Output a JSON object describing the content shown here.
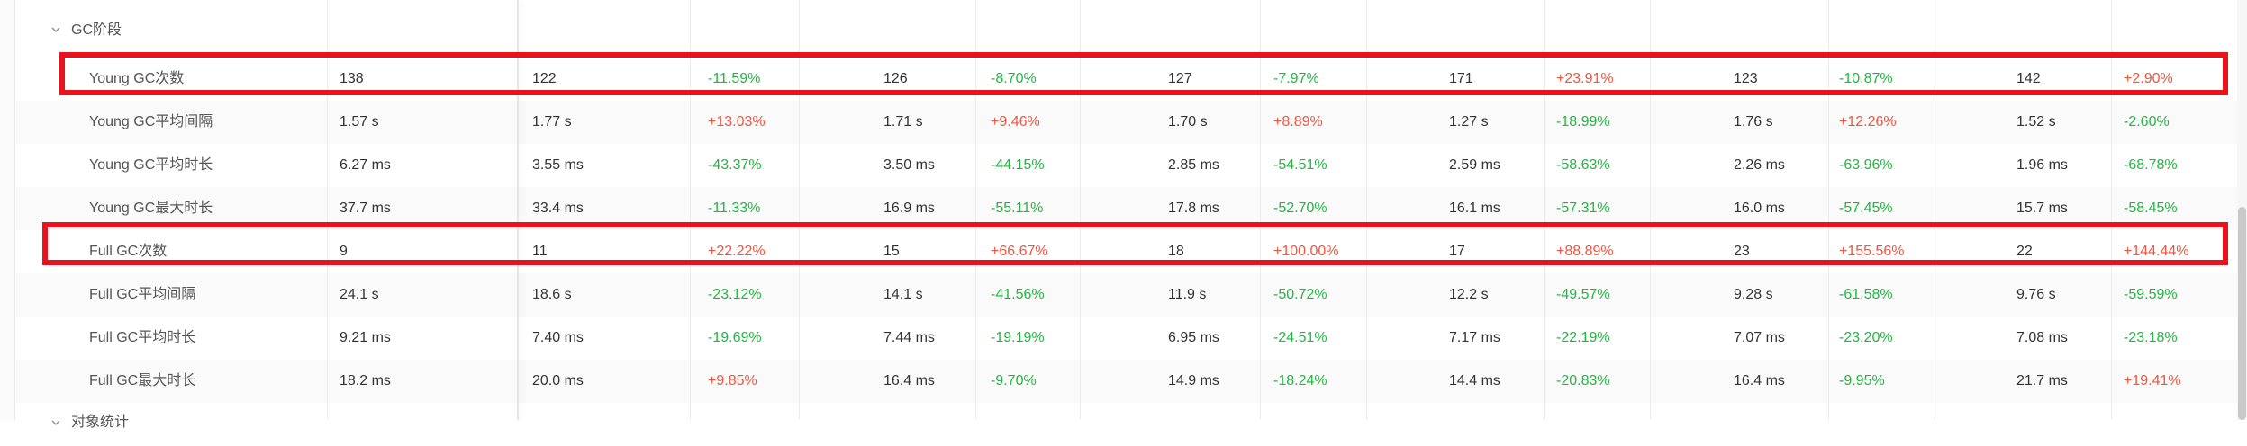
{
  "groups": {
    "gc": {
      "label": "GC阶段"
    },
    "object": {
      "label": "对象统计"
    }
  },
  "rows": [
    {
      "metric": "Young GC次数",
      "cells": [
        "138",
        "122",
        "-11.59%",
        "126",
        "-8.70%",
        "127",
        "-7.97%",
        "171",
        "+23.91%",
        "123",
        "-10.87%",
        "142",
        "+2.90%"
      ]
    },
    {
      "metric": "Young GC平均间隔",
      "cells": [
        "1.57 s",
        "1.77 s",
        "+13.03%",
        "1.71 s",
        "+9.46%",
        "1.70 s",
        "+8.89%",
        "1.27 s",
        "-18.99%",
        "1.76 s",
        "+12.26%",
        "1.52 s",
        "-2.60%"
      ]
    },
    {
      "metric": "Young GC平均时长",
      "cells": [
        "6.27 ms",
        "3.55 ms",
        "-43.37%",
        "3.50 ms",
        "-44.15%",
        "2.85 ms",
        "-54.51%",
        "2.59 ms",
        "-58.63%",
        "2.26 ms",
        "-63.96%",
        "1.96 ms",
        "-68.78%"
      ]
    },
    {
      "metric": "Young GC最大时长",
      "cells": [
        "37.7 ms",
        "33.4 ms",
        "-11.33%",
        "16.9 ms",
        "-55.11%",
        "17.8 ms",
        "-52.70%",
        "16.1 ms",
        "-57.31%",
        "16.0 ms",
        "-57.45%",
        "15.7 ms",
        "-58.45%"
      ]
    },
    {
      "metric": "Full GC次数",
      "cells": [
        "9",
        "11",
        "+22.22%",
        "15",
        "+66.67%",
        "18",
        "+100.00%",
        "17",
        "+88.89%",
        "23",
        "+155.56%",
        "22",
        "+144.44%"
      ]
    },
    {
      "metric": "Full GC平均间隔",
      "cells": [
        "24.1 s",
        "18.6 s",
        "-23.12%",
        "14.1 s",
        "-41.56%",
        "11.9 s",
        "-50.72%",
        "12.2 s",
        "-49.57%",
        "9.28 s",
        "-61.58%",
        "9.76 s",
        "-59.59%"
      ]
    },
    {
      "metric": "Full GC平均时长",
      "cells": [
        "9.21 ms",
        "7.40 ms",
        "-19.69%",
        "7.44 ms",
        "-19.19%",
        "6.95 ms",
        "-24.51%",
        "7.17 ms",
        "-22.19%",
        "7.07 ms",
        "-23.20%",
        "7.08 ms",
        "-23.18%"
      ]
    },
    {
      "metric": "Full GC最大时长",
      "cells": [
        "18.2 ms",
        "20.0 ms",
        "+9.85%",
        "16.4 ms",
        "-9.70%",
        "14.9 ms",
        "-18.24%",
        "14.4 ms",
        "-20.83%",
        "16.4 ms",
        "-9.95%",
        "21.7 ms",
        "+19.41%"
      ]
    }
  ],
  "colors": {
    "increase": "#f5533d",
    "decrease": "#1fb83e",
    "highlight_box": "#e8131c"
  },
  "icons": {
    "group_toggle": "chevron-down-icon"
  }
}
